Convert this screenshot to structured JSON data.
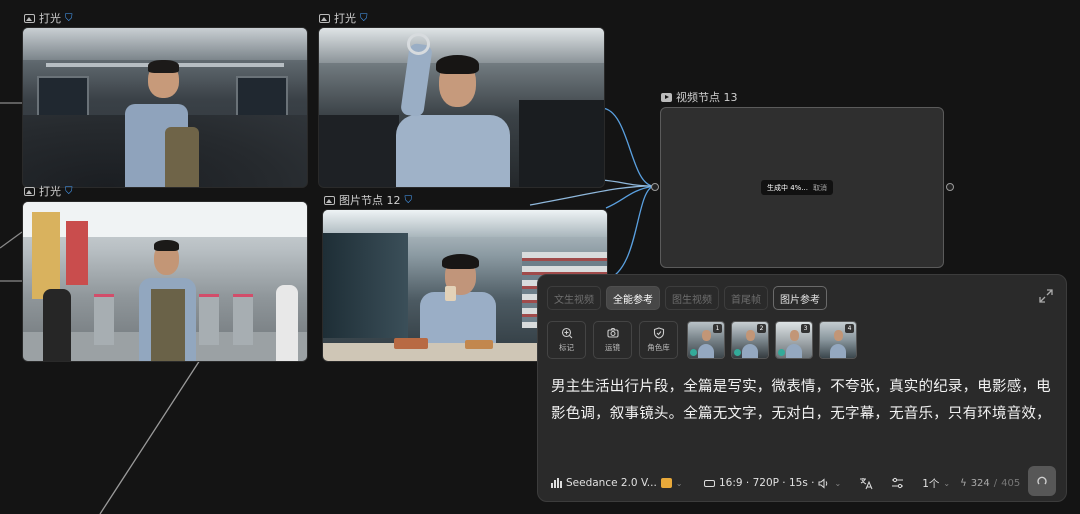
{
  "nodes": {
    "img1_title": "打光",
    "img2_title": "打光",
    "img3_title": "打光",
    "img4_title": "图片节点 12",
    "video_title": "视频节点 13"
  },
  "video": {
    "status": "生成中 4%...",
    "cancel": "取消"
  },
  "panel": {
    "tabs": [
      {
        "label": "文生视频"
      },
      {
        "label": "全能参考"
      },
      {
        "label": "图生视频"
      },
      {
        "label": "首尾帧"
      },
      {
        "label": "图片参考"
      }
    ],
    "tools": [
      {
        "label": "标记",
        "icon": "mark-pin-icon"
      },
      {
        "label": "运镜",
        "icon": "camera-icon"
      },
      {
        "label": "角色库",
        "icon": "shield-person-icon"
      }
    ],
    "refs": [
      "1",
      "2",
      "3",
      "4"
    ],
    "prompt": "男主生活出行片段，全篇是写实，微表情，不夸张，真实的纪录，电影感，电影色调，叙事镜头。全篇无文字，无对白，无字幕，无音乐，只有环境音效，",
    "model": "Seedance 2.0 V...",
    "spec": "16:9 · 720P · 15s ·",
    "count": "1个",
    "credits_used": "324",
    "credits_sep": " / ",
    "credits_total": "405"
  },
  "colors": {
    "background": "#141414",
    "accent_blue": "#4aa3ff",
    "badge_gold": "#e8a93a"
  }
}
